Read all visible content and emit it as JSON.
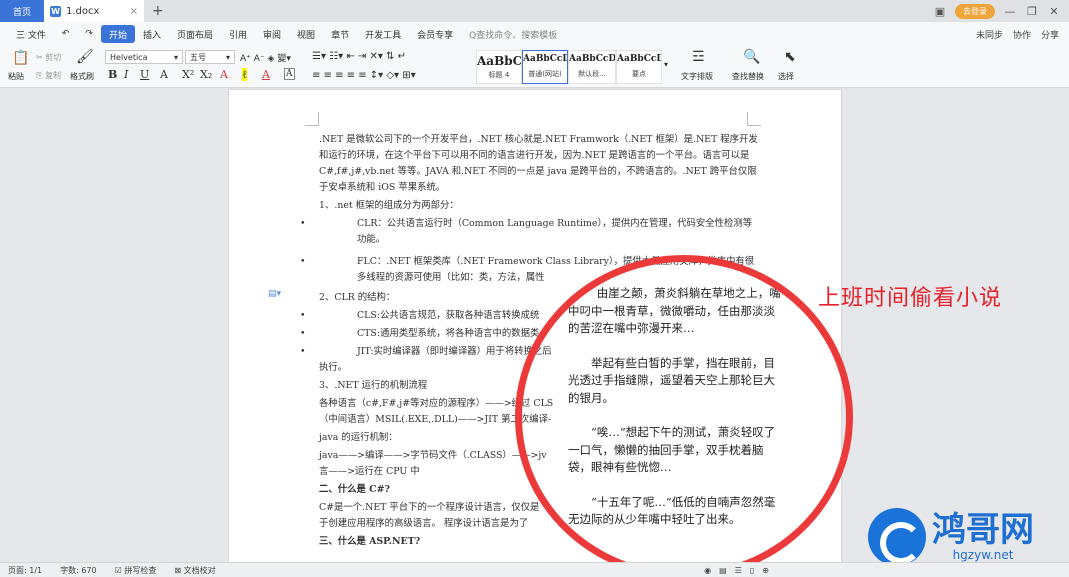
{
  "tabbar": {
    "home": "首页",
    "doc_tab": "1.docx",
    "doc_icon": "W",
    "login": "去登录",
    "close": "×",
    "plus": "+"
  },
  "menubar": {
    "file": "三 文件",
    "items": [
      "开始",
      "插入",
      "页面布局",
      "引用",
      "审阅",
      "视图",
      "章节",
      "开发工具",
      "会员专享"
    ],
    "search": "Q查找命令、搜索模板",
    "right": [
      "未同步",
      "协作",
      "分享"
    ]
  },
  "ribbon": {
    "paste": "粘贴",
    "cut": "剪切",
    "copy": "复制",
    "format_painter": "格式刷",
    "font_name": "Helvetica",
    "font_size": "五号",
    "styles": [
      {
        "sample": "AaBbC",
        "name": "标题 4"
      },
      {
        "sample": "AaBbCcDc",
        "name": "普通(网站)"
      },
      {
        "sample": "AaBbCcDd",
        "name": "默认段..."
      },
      {
        "sample": "AaBbCcDc",
        "name": "要点"
      }
    ],
    "text_layout": "文字排版",
    "find_replace": "查找替换",
    "select": "选择"
  },
  "document": {
    "p1": ".NET 是微软公司下的一个开发平台，.NET 核心就是.NET Framwork（.NET 框架）是.NET 程序开发和运行的环境，在这个平台下可以用不同的语言进行开发，因为.NET 是跨语言的一个平台。语言可以是 C#,f#,j#,vb.net 等等。JAVA 和.NET 不同的一点是 java 是跨平台的，不跨语言的。.NET 跨平台仅限于安卓系统和 iOS 苹果系统。",
    "s1": "1、.net 框架的组成分为两部分：",
    "b1": "CLR：公共语言运行时（Common Language Runtime），提供内在管理，代码安全性检测等功能。",
    "b2": "FLC：.NET 框架类库（.NET Framework Class Library），提供大量应用类库，类库中有很多线程的资源可使用（比如：类，方法，属性",
    "s2": "2、CLR 的结构：",
    "b3": "CLS:公共语言规范，获取各种语言转换成统",
    "b4": "CTS:通用类型系统，将各种语言中的数据类",
    "b5": "JIT:实时编译器（即时编译器）用于将转换之后",
    "b5b": "执行。",
    "s3": "3、.NET 运行的机制流程",
    "p2": "各种语言（c#,F#,j#等对应的源程序）——>经过 CLS",
    "p3": "（中间语言）MSIL(.EXE,.DLL)——>JIT 第二次编译-",
    "p4": "java 的运行机制：",
    "p5": "java——>编译——>字节码文件（.CLASS）——>jv",
    "p6": "言——>运行在 CPU 中",
    "h2": "二、什么是 C#?",
    "p7": "C#是一个.NET 平台下的一个程序设计语言，仅仅是",
    "p8": "于创建应用程序的高级语言。 程序设计语言是为了",
    "h3": "三、什么是 ASP.NET?"
  },
  "novel": {
    "p1": "由崖之颠，萧炎斜躺在草地之上，嘴中叼中一根青草，微微嚼动，任由那淡淡的苦涩在嘴中弥漫开来…",
    "p2": "举起有些白皙的手掌，挡在眼前，目光透过手指缝隙，遥望着天空上那轮巨大的银月。",
    "p3": "“唉…”想起下午的测试，萧炎轻叹了一口气，懒懒的抽回手掌，双手枕着脑袋，眼神有些恍惚…",
    "p4": "“十五年了呢…”低低的自喃声忽然毫无边际的从少年嘴中轻吐了出来。"
  },
  "caption": "上班时间偷看小说",
  "watermark": {
    "name": "鸿哥网",
    "url": "hgzyw.net"
  },
  "status": {
    "page": "页面: 1/1",
    "words": "字数: 670",
    "spell": "拼写检查",
    "proof": "文档校对",
    "zoom": "110%"
  },
  "colors": {
    "accent": "#3a74d8",
    "circle": "#ec3a3a",
    "caption": "#e8202a",
    "watermark": "#1f6fd3"
  }
}
